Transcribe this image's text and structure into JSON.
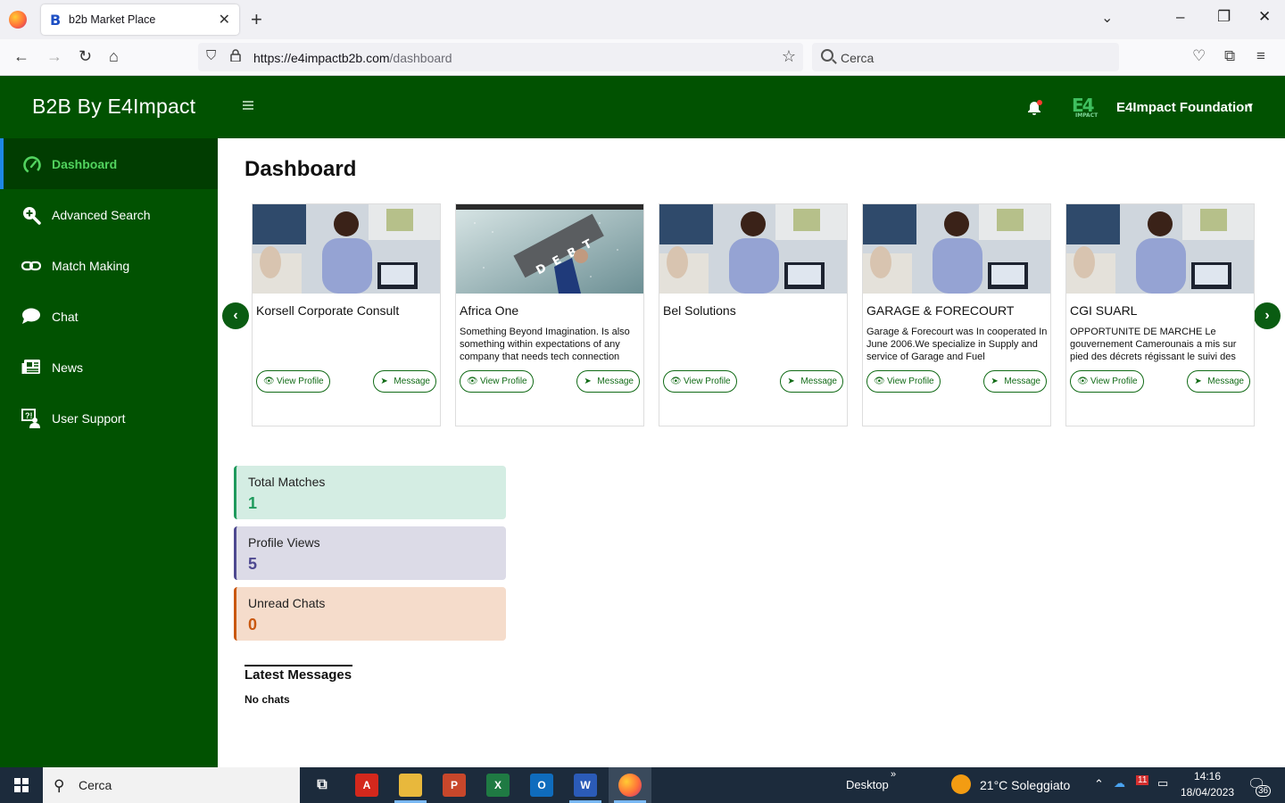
{
  "browser": {
    "tab_title": "b2b Market Place",
    "tab_favicon": "B",
    "url_host": "https://e4impactb2b.com",
    "url_path": "/dashboard",
    "search_placeholder": "Cerca"
  },
  "header": {
    "brand": "B2B By E4Impact",
    "org_name": "E4Impact Foundation",
    "org_logo": "E4",
    "org_logo_sub": "IMPACT"
  },
  "sidebar": {
    "items": [
      {
        "label": "Dashboard",
        "icon": "speedometer-icon",
        "active": true
      },
      {
        "label": "Advanced Search",
        "icon": "search-plus-icon"
      },
      {
        "label": "Match Making",
        "icon": "link-icon"
      },
      {
        "label": "Chat",
        "icon": "chat-bubble-icon"
      },
      {
        "label": "News",
        "icon": "newspaper-icon"
      },
      {
        "label": "User Support",
        "icon": "support-icon"
      }
    ]
  },
  "main": {
    "title": "Dashboard",
    "cards": [
      {
        "name": "Korsell Corporate Consult",
        "desc": "",
        "image": "office-woman-photo"
      },
      {
        "name": "Africa One",
        "desc": "Something Beyond Imagination. Is also something within expectations of any company that needs tech connection",
        "image": "debt-man-photo",
        "image_text": "DEBT"
      },
      {
        "name": "Bel Solutions",
        "desc": "",
        "image": "office-woman-photo"
      },
      {
        "name": "GARAGE & FORECOURT",
        "desc": "Garage & Forecourt was In cooperated In June 2006.We specialize in Supply and service of Garage and Fuel",
        "image": "office-woman-photo"
      },
      {
        "name": "CGI SUARL",
        "desc": "OPPORTUNITE DE MARCHE  Le gouvernement Camerounais a mis sur pied des décrets régissant le suivi des",
        "image": "office-woman-photo"
      }
    ],
    "view_profile_label": "View Profile",
    "message_label": "Message",
    "stats": [
      {
        "label": "Total Matches",
        "value": "1",
        "bg": "#d4ede3",
        "border": "#1f9a5c",
        "color": "#1f9a5c"
      },
      {
        "label": "Profile Views",
        "value": "5",
        "bg": "#dcdbe7",
        "border": "#4e4990",
        "color": "#4e4990"
      },
      {
        "label": "Unread Chats",
        "value": "0",
        "bg": "#f5dccb",
        "border": "#c95810",
        "color": "#c95810"
      }
    ],
    "latest_title": "Latest Messages",
    "no_chats": "No chats"
  },
  "taskbar": {
    "search_placeholder": "Cerca",
    "desktop_label": "Desktop",
    "weather": "21°C  Soleggiato",
    "time": "14:16",
    "date": "18/04/2023",
    "notification_count": "36",
    "calendar_badge": "11"
  }
}
